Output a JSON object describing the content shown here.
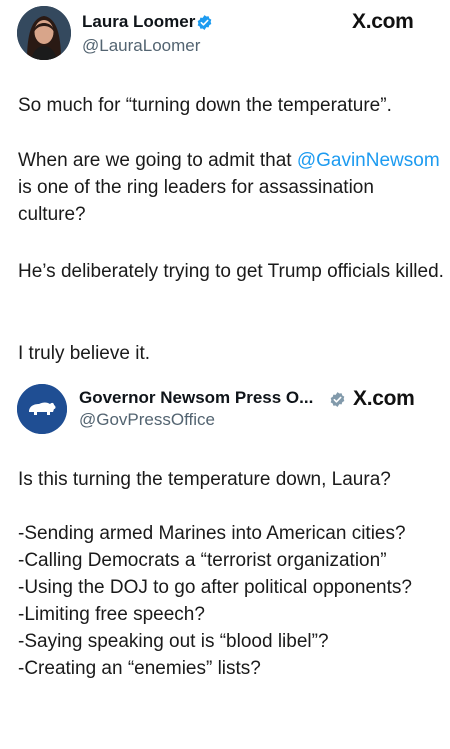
{
  "post1": {
    "author_name": "Laura Loomer",
    "handle": "@LauraLoomer",
    "source": "X.com",
    "paragraphs": {
      "p1": "So much for “turning down the temperature”.",
      "p2_before": "When are we going to admit that ",
      "p2_mention": "@GavinNewsom",
      "p2_after": " is one of the ring leaders for assassination culture?",
      "p3": "He’s deliberately trying to get Trump officials killed.",
      "p4": "I truly believe it."
    }
  },
  "post2": {
    "author_name": "Governor Newsom Press O...",
    "handle": "@GovPressOffice",
    "source": "X.com",
    "paragraphs": {
      "p1": "Is this turning the temperature down, Laura?",
      "p2": "-Sending armed Marines into American cities?\n-Calling Democrats a “terrorist organization”\n-Using the DOJ to go after political opponents?\n-Limiting free speech?\n-Saying speaking out is “blood libel”?\n-Creating an “enemies” lists?"
    }
  },
  "colors": {
    "mention": "#1d9bf0",
    "verified_blue": "#1d9bf0",
    "verified_gray": "#829aab",
    "handle_gray": "#536471"
  },
  "icons": {
    "badge1": "verified-badge-icon",
    "badge2": "verified-government-badge-icon",
    "avatar2": "bear-flag-icon"
  }
}
